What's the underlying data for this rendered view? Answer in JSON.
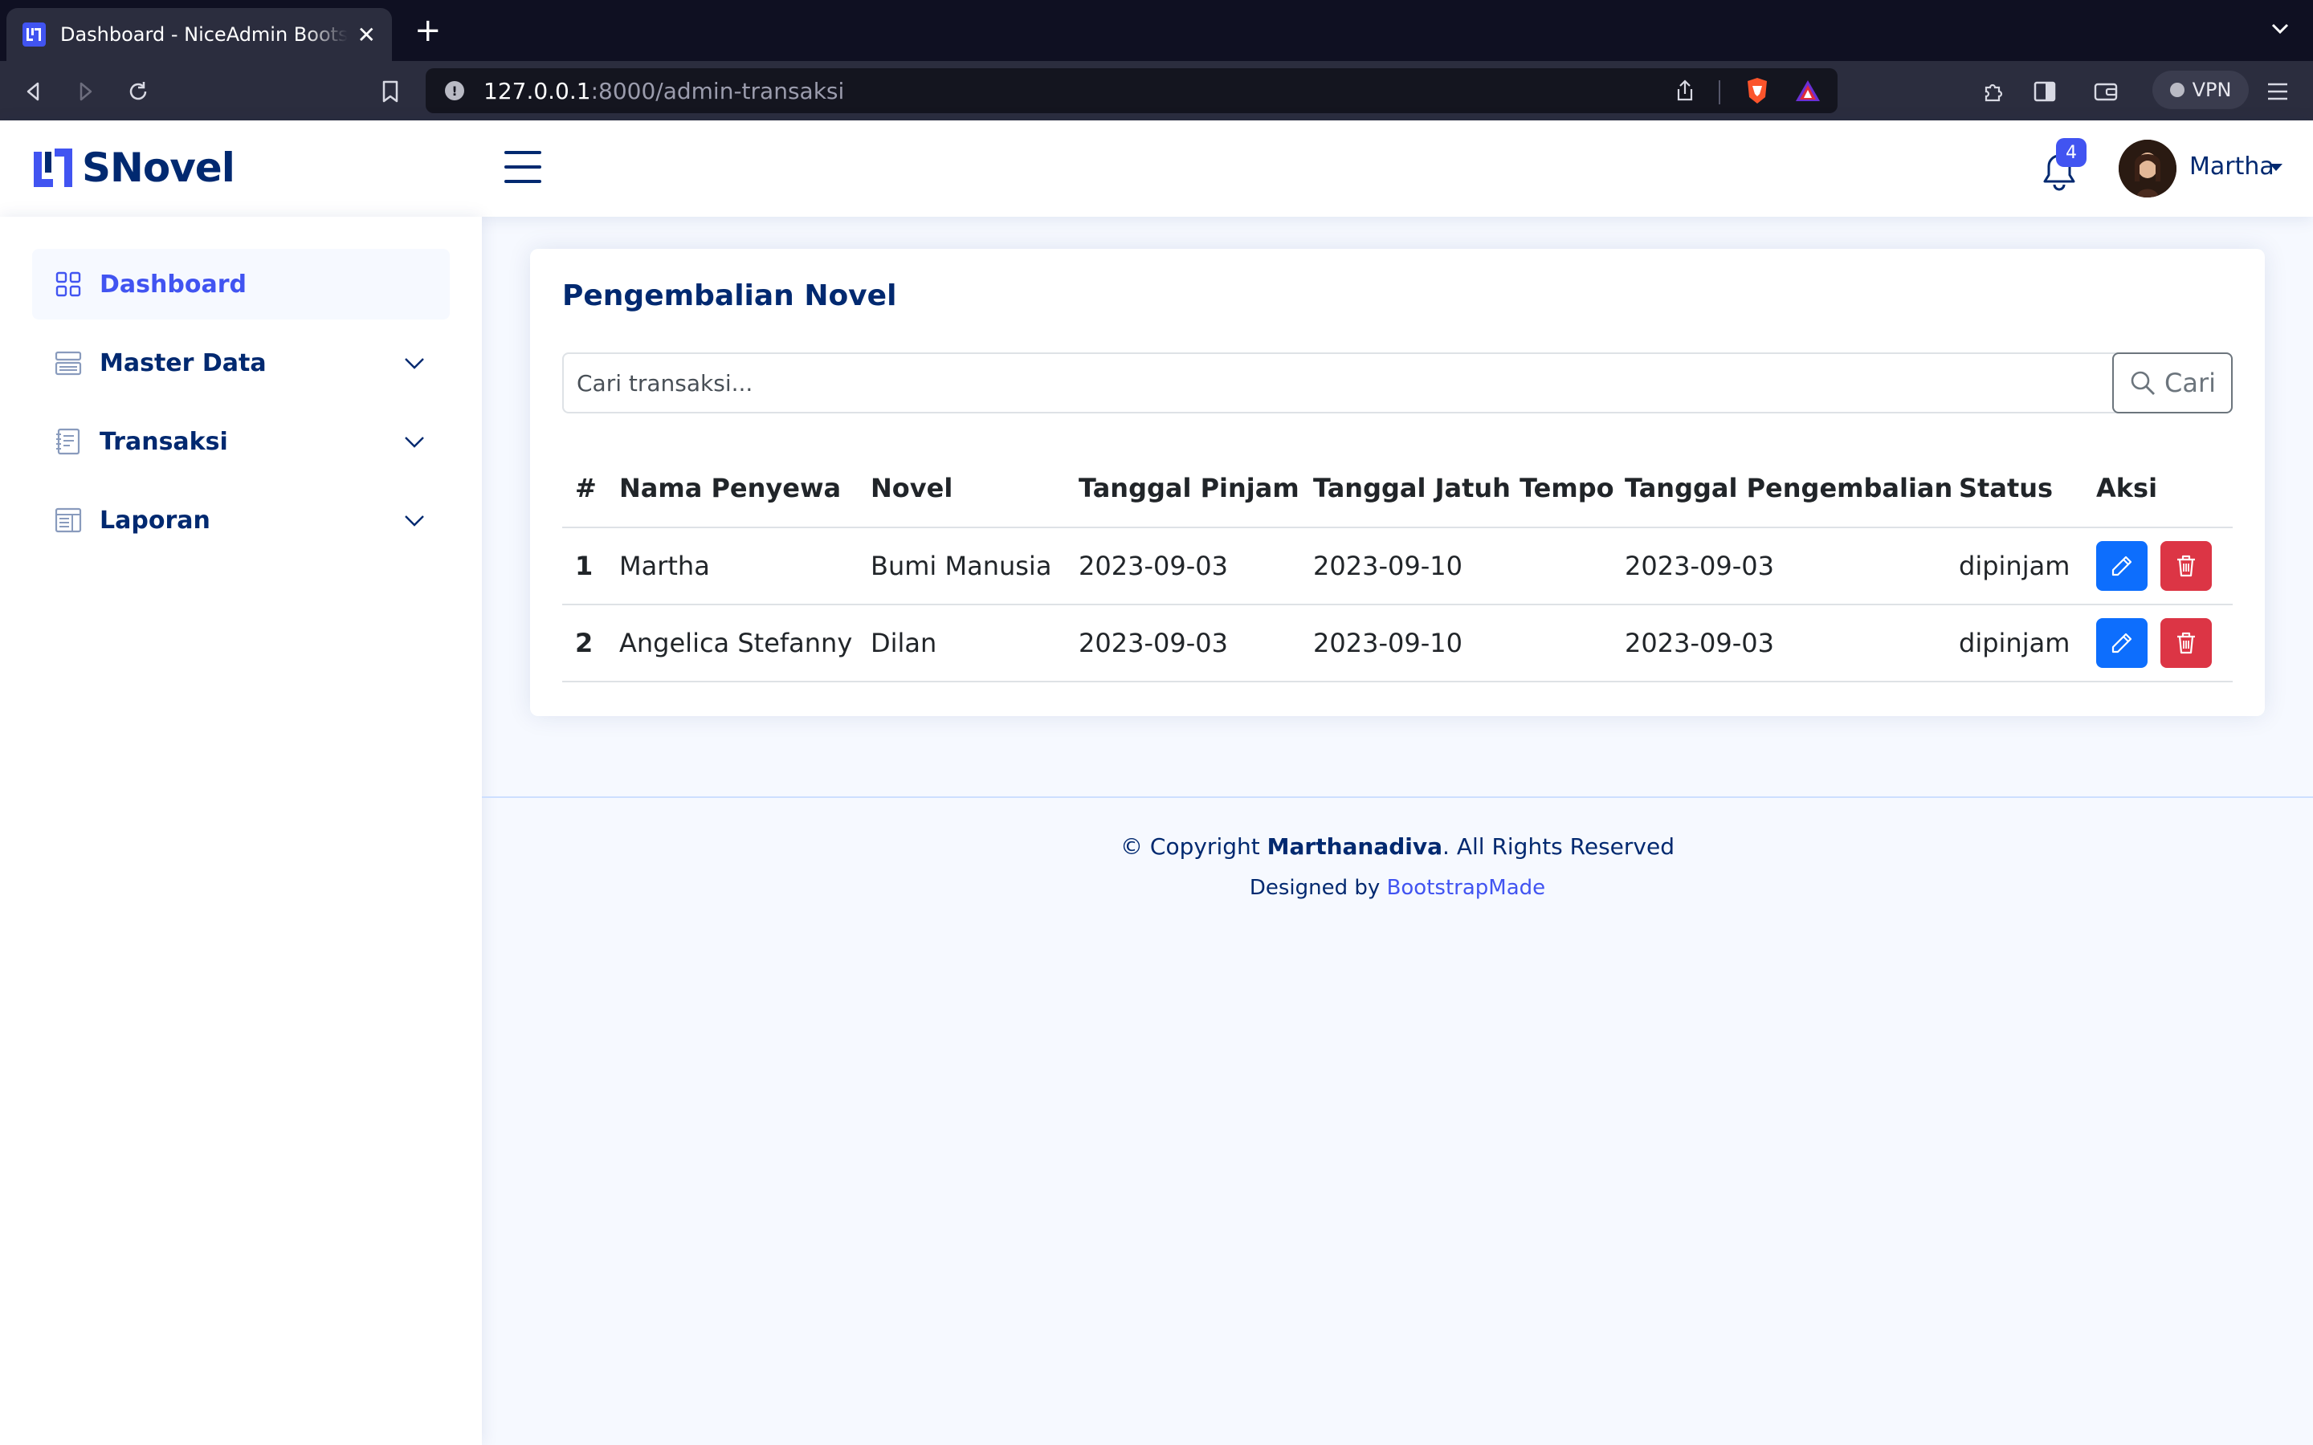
{
  "browser": {
    "tab_title": "Dashboard - NiceAdmin Bootstrap Template",
    "url_host": "127.0.0.1",
    "url_path": ":8000/admin-transaksi",
    "vpn_label": "VPN"
  },
  "header": {
    "brand": "SNovel",
    "notification_count": "4",
    "user_name": "Martha"
  },
  "sidebar": {
    "items": [
      {
        "label": "Dashboard",
        "icon": "grid-icon",
        "active": true
      },
      {
        "label": "Master Data",
        "icon": "menu-button-icon",
        "expandable": true
      },
      {
        "label": "Transaksi",
        "icon": "journal-text-icon",
        "expandable": true
      },
      {
        "label": "Laporan",
        "icon": "layout-text-window-icon",
        "expandable": true
      }
    ]
  },
  "main": {
    "title": "Pengembalian Novel",
    "search_placeholder": "Cari transaksi...",
    "search_button": "Cari",
    "table": {
      "headers": [
        "#",
        "Nama Penyewa",
        "Novel",
        "Tanggal Pinjam",
        "Tanggal Jatuh Tempo",
        "Tanggal Pengembalian",
        "Status",
        "Aksi"
      ],
      "rows": [
        [
          "1",
          "Martha",
          "Bumi Manusia",
          "2023-09-03",
          "2023-09-10",
          "2023-09-03",
          "dipinjam"
        ],
        [
          "2",
          "Angelica Stefanny",
          "Dilan",
          "2023-09-03",
          "2023-09-10",
          "2023-09-03",
          "dipinjam"
        ]
      ]
    }
  },
  "footer": {
    "copyright_prefix": "© Copyright ",
    "copyright_owner": "Marthanadiva",
    "copyright_suffix": ". All Rights Reserved",
    "designed_by": "Designed by ",
    "designer_link": "BootstrapMade"
  },
  "colors": {
    "primary": "#4154f1",
    "navy": "#012970",
    "edit": "#0d6efd",
    "delete": "#dc3545",
    "page_bg": "#f6f9ff"
  }
}
